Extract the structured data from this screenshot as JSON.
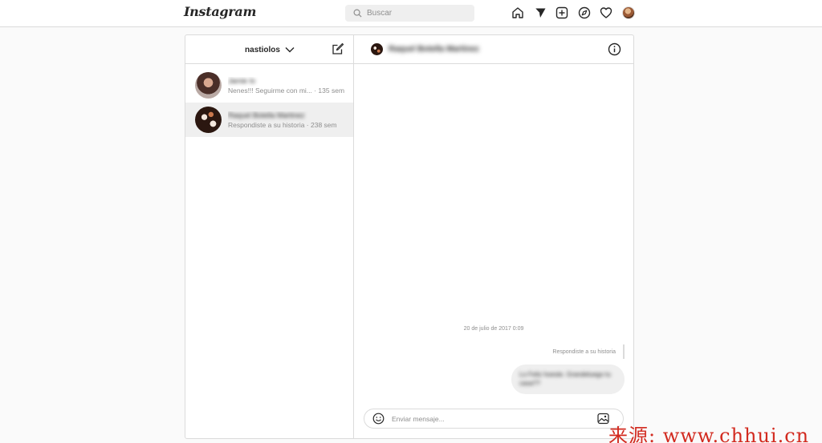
{
  "app": {
    "logo_text": "Instagram"
  },
  "search": {
    "placeholder": "Buscar"
  },
  "nav": {
    "icons": [
      "home-icon",
      "direct-icon",
      "new-post-icon",
      "explore-icon",
      "activity-heart-icon",
      "profile-avatar"
    ]
  },
  "inbox": {
    "account_name": "nastiolos",
    "threads": [
      {
        "name": "Jamie Io",
        "preview": "Nenes!!! Seguirme con mi... · 135 sem",
        "selected": false
      },
      {
        "name": "Raquel Botella Martinez",
        "preview": "Respondiste a su historia · 238 sem",
        "selected": true
      }
    ]
  },
  "chat": {
    "contact_name": "Raquel Botella Martinez",
    "date": "20 de julio de 2017 0:09",
    "replied_label": "Respondiste a su historia",
    "message": "Lo Feliz hoeste. Grandeluego tu casa??",
    "composer_placeholder": "Enviar mensaje..."
  },
  "watermark": "来源: www.chhui.cn",
  "colors": {
    "border": "#dbdbdb",
    "muted_text": "#8e8e8e",
    "selected_row": "#efefef",
    "watermark": "#d22a1f"
  }
}
